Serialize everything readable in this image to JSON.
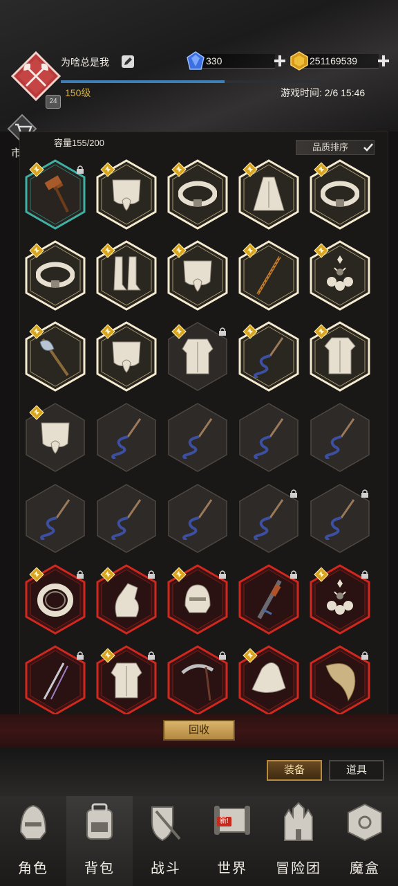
{
  "header": {
    "player_name": "为啥总是我",
    "player_level_text": "150级",
    "level_badge": "24",
    "xp_progress_percent": 63,
    "gems": "330",
    "gold": "251169539",
    "game_time": "游戏时间: 2/6 15:46",
    "market_label": "市集"
  },
  "inventory": {
    "capacity": "容量155/200",
    "sort_label": "品质排序",
    "items": [
      {
        "frame": "teal",
        "icon": "hammer-icon",
        "starred": true,
        "locked": true
      },
      {
        "frame": "gold",
        "icon": "cloth-pants-icon",
        "starred": true,
        "locked": false
      },
      {
        "frame": "gold",
        "icon": "belt-icon",
        "starred": true,
        "locked": false
      },
      {
        "frame": "gold",
        "icon": "cloak-icon",
        "starred": true,
        "locked": false
      },
      {
        "frame": "gold",
        "icon": "belt-icon",
        "starred": true,
        "locked": false
      },
      {
        "frame": "gold",
        "icon": "belt-icon",
        "starred": true,
        "locked": false
      },
      {
        "frame": "gold",
        "icon": "boots-icon",
        "starred": true,
        "locked": false
      },
      {
        "frame": "gold",
        "icon": "cloth-pants-icon",
        "starred": true,
        "locked": false
      },
      {
        "frame": "gold",
        "icon": "staff-icon",
        "starred": true,
        "locked": false
      },
      {
        "frame": "gold",
        "icon": "amulet-icon",
        "starred": true,
        "locked": false
      },
      {
        "frame": "gold",
        "icon": "battle-axe-icon",
        "starred": true,
        "locked": false
      },
      {
        "frame": "gold",
        "icon": "cloth-pants-icon",
        "starred": true,
        "locked": false
      },
      {
        "frame": "plain",
        "icon": "armor-icon",
        "starred": true,
        "locked": true
      },
      {
        "frame": "gold",
        "icon": "whip-icon",
        "starred": true,
        "locked": false
      },
      {
        "frame": "gold",
        "icon": "robe-icon",
        "starred": true,
        "locked": false
      },
      {
        "frame": "plain",
        "icon": "cloth-pants-icon",
        "starred": true,
        "locked": false
      },
      {
        "frame": "plain",
        "icon": "whip-icon",
        "starred": false,
        "locked": false
      },
      {
        "frame": "plain",
        "icon": "whip-icon",
        "starred": false,
        "locked": false
      },
      {
        "frame": "plain",
        "icon": "whip-icon",
        "starred": false,
        "locked": false
      },
      {
        "frame": "plain",
        "icon": "whip-icon",
        "starred": false,
        "locked": false
      },
      {
        "frame": "plain",
        "icon": "whip-icon",
        "starred": false,
        "locked": false
      },
      {
        "frame": "plain",
        "icon": "whip-icon",
        "starred": false,
        "locked": false
      },
      {
        "frame": "plain",
        "icon": "whip-icon",
        "starred": false,
        "locked": false
      },
      {
        "frame": "plain",
        "icon": "whip-icon",
        "starred": false,
        "locked": true
      },
      {
        "frame": "plain",
        "icon": "whip-icon",
        "starred": false,
        "locked": true
      },
      {
        "frame": "red",
        "icon": "ring-icon",
        "starred": true,
        "locked": true
      },
      {
        "frame": "red",
        "icon": "gauntlet-icon",
        "starred": true,
        "locked": true
      },
      {
        "frame": "red",
        "icon": "helmet-icon",
        "starred": true,
        "locked": true
      },
      {
        "frame": "red",
        "icon": "crossbow-icon",
        "starred": false,
        "locked": true
      },
      {
        "frame": "red",
        "icon": "amulet-icon",
        "starred": true,
        "locked": true
      },
      {
        "frame": "red",
        "icon": "twin-swords-icon",
        "starred": false,
        "locked": true
      },
      {
        "frame": "red",
        "icon": "armor-icon",
        "starred": true,
        "locked": true
      },
      {
        "frame": "red",
        "icon": "scythe-icon",
        "starred": false,
        "locked": true
      },
      {
        "frame": "red",
        "icon": "wizard-hat-icon",
        "starred": true,
        "locked": false
      },
      {
        "frame": "red",
        "icon": "horn-icon",
        "starred": false,
        "locked": true
      }
    ]
  },
  "actions": {
    "recycle": "回收",
    "tab_equipment": "装备",
    "tab_props": "道具"
  },
  "nav": [
    {
      "label": "角色",
      "icon": "helmet-icon",
      "active": false
    },
    {
      "label": "背包",
      "icon": "backpack-icon",
      "active": true
    },
    {
      "label": "战斗",
      "icon": "shield-sword-icon",
      "active": false
    },
    {
      "label": "世界",
      "icon": "scroll-map-icon",
      "active": false,
      "badge": "新!"
    },
    {
      "label": "冒险团",
      "icon": "castle-icon",
      "active": false
    },
    {
      "label": "魔盒",
      "icon": "magic-cube-icon",
      "active": false
    }
  ],
  "colors": {
    "gold_frame": "#e8dcb4",
    "red_frame": "#c8261d",
    "teal_frame": "#3fb0a4",
    "accent_gold": "#d3b24a"
  }
}
